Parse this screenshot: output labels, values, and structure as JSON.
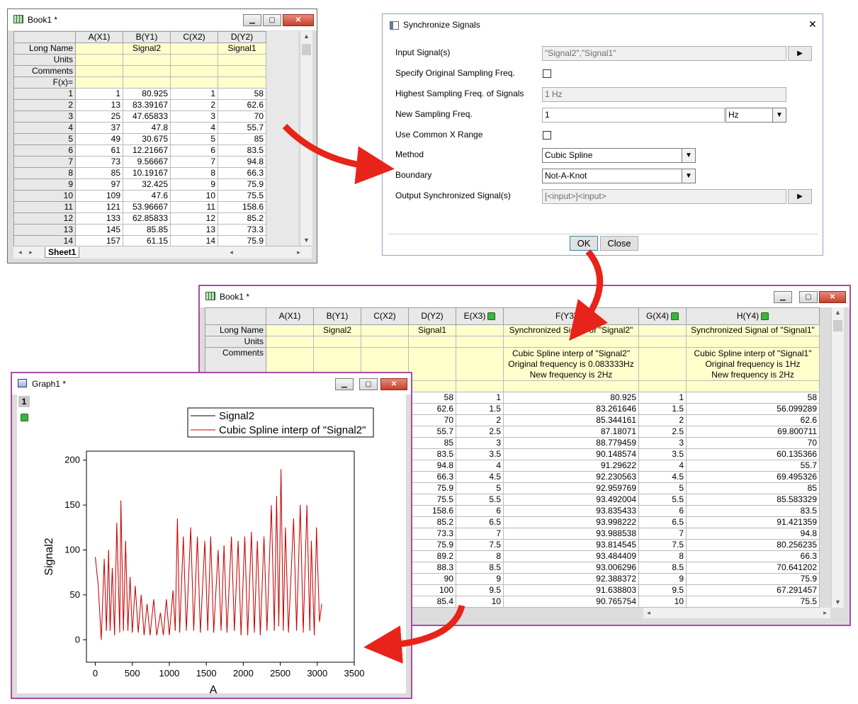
{
  "book1_top": {
    "title": "Book1 *",
    "columns": [
      "A(X1)",
      "B(Y1)",
      "C(X2)",
      "D(Y2)"
    ],
    "meta_rows": [
      {
        "label": "Long Name",
        "cells": [
          "",
          "Signal2",
          "",
          "Signal1"
        ]
      },
      {
        "label": "Units",
        "cells": [
          "",
          "",
          "",
          ""
        ]
      },
      {
        "label": "Comments",
        "cells": [
          "",
          "",
          "",
          ""
        ]
      },
      {
        "label": "F(x)=",
        "cells": [
          "",
          "",
          "",
          ""
        ]
      }
    ],
    "rows": [
      [
        "1",
        "1",
        "80.925",
        "1",
        "58"
      ],
      [
        "2",
        "13",
        "83.39167",
        "2",
        "62.6"
      ],
      [
        "3",
        "25",
        "47.65833",
        "3",
        "70"
      ],
      [
        "4",
        "37",
        "47.8",
        "4",
        "55.7"
      ],
      [
        "5",
        "49",
        "30.675",
        "5",
        "85"
      ],
      [
        "6",
        "61",
        "12.21667",
        "6",
        "83.5"
      ],
      [
        "7",
        "73",
        "9.56667",
        "7",
        "94.8"
      ],
      [
        "8",
        "85",
        "10.19167",
        "8",
        "66.3"
      ],
      [
        "9",
        "97",
        "32.425",
        "9",
        "75.9"
      ],
      [
        "10",
        "109",
        "47.6",
        "10",
        "75.5"
      ],
      [
        "11",
        "121",
        "53.96667",
        "11",
        "158.6"
      ],
      [
        "12",
        "133",
        "62.85833",
        "12",
        "85.2"
      ],
      [
        "13",
        "145",
        "85.85",
        "13",
        "73.3"
      ],
      [
        "14",
        "157",
        "61.15",
        "14",
        "75.9"
      ]
    ],
    "sheet_tab": "Sheet1"
  },
  "dialog": {
    "title": "Synchronize Signals",
    "close_glyph": "✕",
    "fields": {
      "input_signals_label": "Input Signal(s)",
      "input_signals_value": "\"Signal2\",\"Signal1\"",
      "specify_orig_label": "Specify Original Sampling Freq.",
      "highest_label": "Highest Sampling Freq. of Signals",
      "highest_value": "1 Hz",
      "new_freq_label": "New Sampling Freq.",
      "new_freq_value": "1",
      "new_freq_unit": "Hz",
      "common_x_label": "Use Common X Range",
      "method_label": "Method",
      "method_value": "Cubic Spline",
      "boundary_label": "Boundary",
      "boundary_value": "Not-A-Knot",
      "output_label": "Output Synchronized Signal(s)",
      "output_value": "[<input>]<input>"
    },
    "ok_label": "OK",
    "close_label": "Close",
    "arrow_glyph": "▶",
    "dropdown_glyph": "▼"
  },
  "book1_bottom": {
    "title": "Book1 *",
    "columns": [
      "A(X1)",
      "B(Y1)",
      "C(X2)",
      "D(Y2)",
      "E(X3)",
      "F(Y3)",
      "G(X4)",
      "H(Y4)"
    ],
    "long_names": [
      "",
      "Signal2",
      "",
      "Signal1",
      "",
      "Synchronized Signal of \"Signal2\"",
      "",
      "Synchronized Signal of \"Signal1\""
    ],
    "comments_f": [
      "Cubic Spline interp of \"Signal2\"",
      "Original frequency is 0.083333Hz",
      "New frequency is 2Hz"
    ],
    "comments_h": [
      "Cubic Spline interp of \"Signal1\"",
      "Original frequency is 1Hz",
      "New frequency is 2Hz"
    ],
    "meta_labels": [
      "Long Name",
      "Units",
      "Comments"
    ],
    "rows": [
      [
        "58",
        "1",
        "80.925",
        "1",
        "58"
      ],
      [
        "62.6",
        "1.5",
        "83.261646",
        "1.5",
        "56.099289"
      ],
      [
        "70",
        "2",
        "85.344161",
        "2",
        "62.6"
      ],
      [
        "55.7",
        "2.5",
        "87.18071",
        "2.5",
        "69.800711"
      ],
      [
        "85",
        "3",
        "88.779459",
        "3",
        "70"
      ],
      [
        "83.5",
        "3.5",
        "90.148574",
        "3.5",
        "60.135366"
      ],
      [
        "94.8",
        "4",
        "91.29622",
        "4",
        "55.7"
      ],
      [
        "66.3",
        "4.5",
        "92.230563",
        "4.5",
        "69.495326"
      ],
      [
        "75.9",
        "5",
        "92.959769",
        "5",
        "85"
      ],
      [
        "75.5",
        "5.5",
        "93.492004",
        "5.5",
        "85.583329"
      ],
      [
        "158.6",
        "6",
        "93.835433",
        "6",
        "83.5"
      ],
      [
        "85.2",
        "6.5",
        "93.998222",
        "6.5",
        "91.421359"
      ],
      [
        "73.3",
        "7",
        "93.988538",
        "7",
        "94.8"
      ],
      [
        "75.9",
        "7.5",
        "93.814545",
        "7.5",
        "80.256235"
      ],
      [
        "89.2",
        "8",
        "93.484409",
        "8",
        "66.3"
      ],
      [
        "88.3",
        "8.5",
        "93.006296",
        "8.5",
        "70.641202"
      ],
      [
        "90",
        "9",
        "92.388372",
        "9",
        "75.9"
      ],
      [
        "100",
        "9.5",
        "91.638803",
        "9.5",
        "67.291457"
      ],
      [
        "85.4",
        "10",
        "90.765754",
        "10",
        "75.5"
      ]
    ]
  },
  "graph": {
    "title": "Graph1 *",
    "layer_label": "1",
    "legend": [
      "Signal2",
      "Cubic Spline interp of \"Signal2\""
    ],
    "xlabel": "A",
    "ylabel": "Signal2",
    "colors": {
      "signal2": "#000000",
      "interp": "#cc0000"
    }
  },
  "chart_data": {
    "type": "line",
    "xlim": [
      -120,
      3500
    ],
    "ylim": [
      -25,
      210
    ],
    "x_ticks": [
      "0",
      "500",
      "1000",
      "1500",
      "2000",
      "2500",
      "3000",
      "3500"
    ],
    "y_ticks": [
      "0",
      "50",
      "100",
      "150",
      "200"
    ],
    "x": [
      1,
      13,
      25,
      37,
      49,
      61,
      73,
      85,
      97,
      109,
      121,
      133,
      145,
      157
    ],
    "series": [
      {
        "name": "Signal2",
        "values": [
          80.925,
          83.39167,
          47.65833,
          47.8,
          30.675,
          12.21667,
          9.56667,
          10.19167,
          32.425,
          47.6,
          53.96667,
          62.85833,
          85.85,
          61.15
        ]
      },
      {
        "name": "Cubic Spline interp of \"Signal2\"",
        "values": [
          80.925,
          83.39167,
          47.65833,
          47.8,
          30.675,
          12.21667,
          9.56667,
          10.19167,
          32.425,
          47.6,
          53.96667,
          62.85833,
          85.85,
          61.15
        ]
      }
    ],
    "peaks": [
      [
        0,
        92
      ],
      [
        40,
        60
      ],
      [
        80,
        0
      ],
      [
        120,
        90
      ],
      [
        150,
        10
      ],
      [
        180,
        100
      ],
      [
        200,
        10
      ],
      [
        230,
        80
      ],
      [
        260,
        5
      ],
      [
        290,
        130
      ],
      [
        330,
        8
      ],
      [
        345,
        155
      ],
      [
        380,
        10
      ],
      [
        410,
        110
      ],
      [
        440,
        10
      ],
      [
        470,
        70
      ],
      [
        500,
        8
      ],
      [
        540,
        60
      ],
      [
        580,
        8
      ],
      [
        620,
        50
      ],
      [
        660,
        5
      ],
      [
        700,
        40
      ],
      [
        740,
        5
      ],
      [
        790,
        45
      ],
      [
        830,
        5
      ],
      [
        880,
        30
      ],
      [
        920,
        5
      ],
      [
        960,
        45
      ],
      [
        1000,
        5
      ],
      [
        1050,
        55
      ],
      [
        1080,
        10
      ],
      [
        1110,
        135
      ],
      [
        1140,
        8
      ],
      [
        1190,
        115
      ],
      [
        1230,
        10
      ],
      [
        1290,
        125
      ],
      [
        1330,
        10
      ],
      [
        1380,
        115
      ],
      [
        1420,
        8
      ],
      [
        1480,
        110
      ],
      [
        1520,
        10
      ],
      [
        1560,
        115
      ],
      [
        1600,
        8
      ],
      [
        1660,
        100
      ],
      [
        1700,
        10
      ],
      [
        1740,
        105
      ],
      [
        1780,
        8
      ],
      [
        1840,
        115
      ],
      [
        1880,
        10
      ],
      [
        1930,
        110
      ],
      [
        1970,
        5
      ],
      [
        2020,
        115
      ],
      [
        2060,
        5
      ],
      [
        2110,
        120
      ],
      [
        2150,
        8
      ],
      [
        2190,
        110
      ],
      [
        2230,
        5
      ],
      [
        2280,
        115
      ],
      [
        2320,
        10
      ],
      [
        2380,
        150
      ],
      [
        2420,
        10
      ],
      [
        2450,
        160
      ],
      [
        2480,
        15
      ],
      [
        2510,
        190
      ],
      [
        2540,
        10
      ],
      [
        2570,
        125
      ],
      [
        2610,
        8
      ],
      [
        2680,
        135
      ],
      [
        2720,
        10
      ],
      [
        2770,
        150
      ],
      [
        2810,
        8
      ],
      [
        2860,
        150
      ],
      [
        2900,
        10
      ],
      [
        2920,
        110
      ],
      [
        2960,
        5
      ],
      [
        2990,
        125
      ],
      [
        3030,
        20
      ],
      [
        3060,
        40
      ]
    ]
  }
}
